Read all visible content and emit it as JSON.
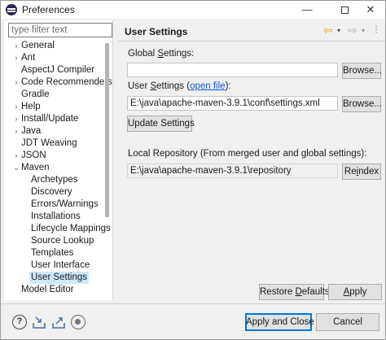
{
  "window": {
    "title": "Preferences",
    "minimize_glyph": "—",
    "close_glyph": "✕"
  },
  "filter": {
    "placeholder": "type filter text",
    "value": ""
  },
  "tree": {
    "items": [
      {
        "label": "General",
        "expanded": false,
        "selected": false
      },
      {
        "label": "Ant",
        "expanded": false,
        "selected": false
      },
      {
        "label": "AspectJ Compiler",
        "expanded": false,
        "selected": false
      },
      {
        "label": "Code Recommenders",
        "expanded": false,
        "selected": false
      },
      {
        "label": "Gradle",
        "expanded": false,
        "selected": false
      },
      {
        "label": "Help",
        "expanded": false,
        "selected": false
      },
      {
        "label": "Install/Update",
        "expanded": false,
        "selected": false
      },
      {
        "label": "Java",
        "expanded": false,
        "selected": false
      },
      {
        "label": "JDT Weaving",
        "expanded": false,
        "selected": false
      },
      {
        "label": "JSON",
        "expanded": false,
        "selected": false
      },
      {
        "label": "Maven",
        "expanded": true,
        "selected": false
      },
      {
        "label": "Archetypes",
        "expanded": false,
        "selected": false
      },
      {
        "label": "Discovery",
        "expanded": false,
        "selected": false
      },
      {
        "label": "Errors/Warnings",
        "expanded": false,
        "selected": false
      },
      {
        "label": "Installations",
        "expanded": false,
        "selected": false
      },
      {
        "label": "Lifecycle Mappings",
        "expanded": false,
        "selected": false
      },
      {
        "label": "Source Lookup",
        "expanded": false,
        "selected": false
      },
      {
        "label": "Templates",
        "expanded": false,
        "selected": false
      },
      {
        "label": "User Interface",
        "expanded": false,
        "selected": false
      },
      {
        "label": "User Settings",
        "expanded": false,
        "selected": true
      },
      {
        "label": "Model Editor",
        "expanded": false,
        "selected": false
      }
    ],
    "collapsed_arrow": "›",
    "expanded_arrow": "⌄"
  },
  "page": {
    "title": "User Settings",
    "nav_back_glyph": "⇦",
    "nav_forward_glyph": "⇨",
    "nav_dropdown_glyph": "▾",
    "nav_menu_glyph": "⋮",
    "global_settings_label_pre": "Global ",
    "global_settings_label_mnemonic": "S",
    "global_settings_label_post": "ettings:",
    "global_settings_value": "",
    "user_settings_label_pre": "User ",
    "user_settings_label_mnemonic": "S",
    "user_settings_label_post": "ettings (",
    "user_settings_link": "open file",
    "user_settings_label_end": "):",
    "user_settings_value": "E:\\java\\apache-maven-3.9.1\\conf\\settings.xml",
    "browse_label": "Browse...",
    "update_settings_label": "Update Settings",
    "local_repo_label": "Local Repository (From merged user and global settings):",
    "local_repo_value": "E:\\java\\apache-maven-3.9.1\\repository",
    "reindex_label_pre": "Re",
    "reindex_label_mnemonic": "i",
    "reindex_label_post": "ndex",
    "restore_defaults_label_pre": "Restore ",
    "restore_defaults_label_mnemonic": "D",
    "restore_defaults_label_post": "efaults",
    "apply_label_mnemonic": "A",
    "apply_label_post": "pply"
  },
  "footer": {
    "help_glyph": "?",
    "apply_and_close_label": "Apply and Close",
    "cancel_label": "Cancel"
  }
}
